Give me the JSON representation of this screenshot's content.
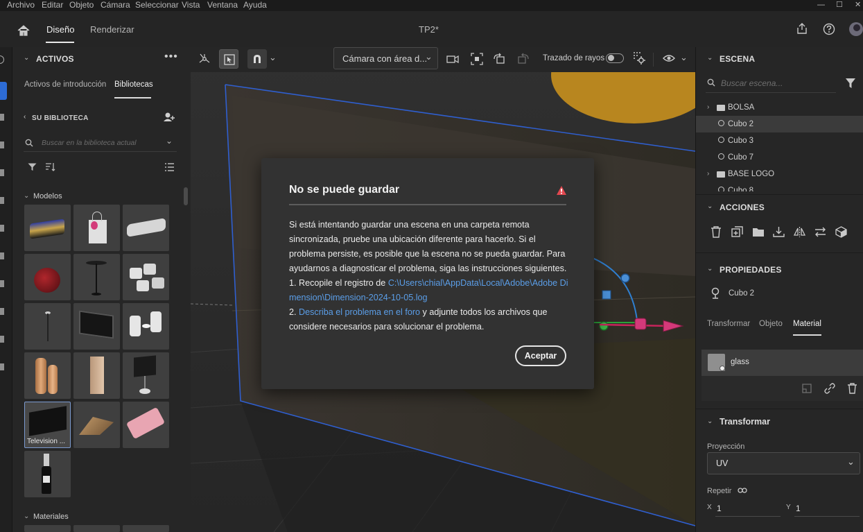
{
  "menu": [
    "Archivo",
    "Editar",
    "Objeto",
    "Cámara",
    "Seleccionar",
    "Vista",
    "Ventana",
    "Ayuda"
  ],
  "window_controls": {
    "minimize": "—",
    "maximize": "☐",
    "close": "✕"
  },
  "header": {
    "home_icon": "home-icon",
    "tab_design": "Diseño",
    "tab_render": "Renderizar",
    "doc_title": "TP2*"
  },
  "left": {
    "title": "ACTIVOS",
    "tabs": [
      "Activos de introducción",
      "Bibliotecas"
    ],
    "library_label": "SU BIBLIOTECA",
    "search_placeholder": "Buscar en la biblioteca actual",
    "models_label": "Modelos",
    "materials_label": "Materiales",
    "selected_thumb_label": "Television ..."
  },
  "viewport": {
    "camera_label": "Cámara con área d...",
    "raytrace_label": "Trazado de rayos"
  },
  "dialog": {
    "title": "No se puede guardar",
    "p1": "Si está intentando guardar una escena en una carpeta remota sincronizada, pruebe una ubicación diferente para hacerlo. Si el problema persiste, es posible que la escena no se pueda guardar. Para ayudarnos a diagnosticar el problema, siga las instrucciones siguientes.",
    "step1_prefix": "1. Recopile el registro de ",
    "step1_link": "C:\\Users\\chial\\AppData\\Local\\Adobe\\Adobe Dimension\\Dimension-2024-10-05.log",
    "step2_prefix": "2. ",
    "step2_link": "Describa el problema en el foro",
    "step2_suffix": " y adjunte todos los archivos que considere necesarios para solucionar el problema.",
    "ok_button": "Aceptar"
  },
  "right": {
    "scene_title": "ESCENA",
    "search_placeholder": "Buscar escena...",
    "tree": [
      "BOLSA",
      "Cubo 2",
      "Cubo 3",
      "Cubo 7",
      "BASE LOGO",
      "Cubo 8"
    ],
    "actions_title": "ACCIONES",
    "props_title": "PROPIEDADES",
    "selected_object": "Cubo 2",
    "prop_tabs": [
      "Transformar",
      "Objeto",
      "Material"
    ],
    "material_name": "glass",
    "transform_title": "Transformar",
    "projection_label": "Proyección",
    "projection_value": "UV",
    "repeat_label": "Repetir",
    "x_label": "X",
    "x_value": "1",
    "y_label": "Y",
    "y_value": "1"
  }
}
